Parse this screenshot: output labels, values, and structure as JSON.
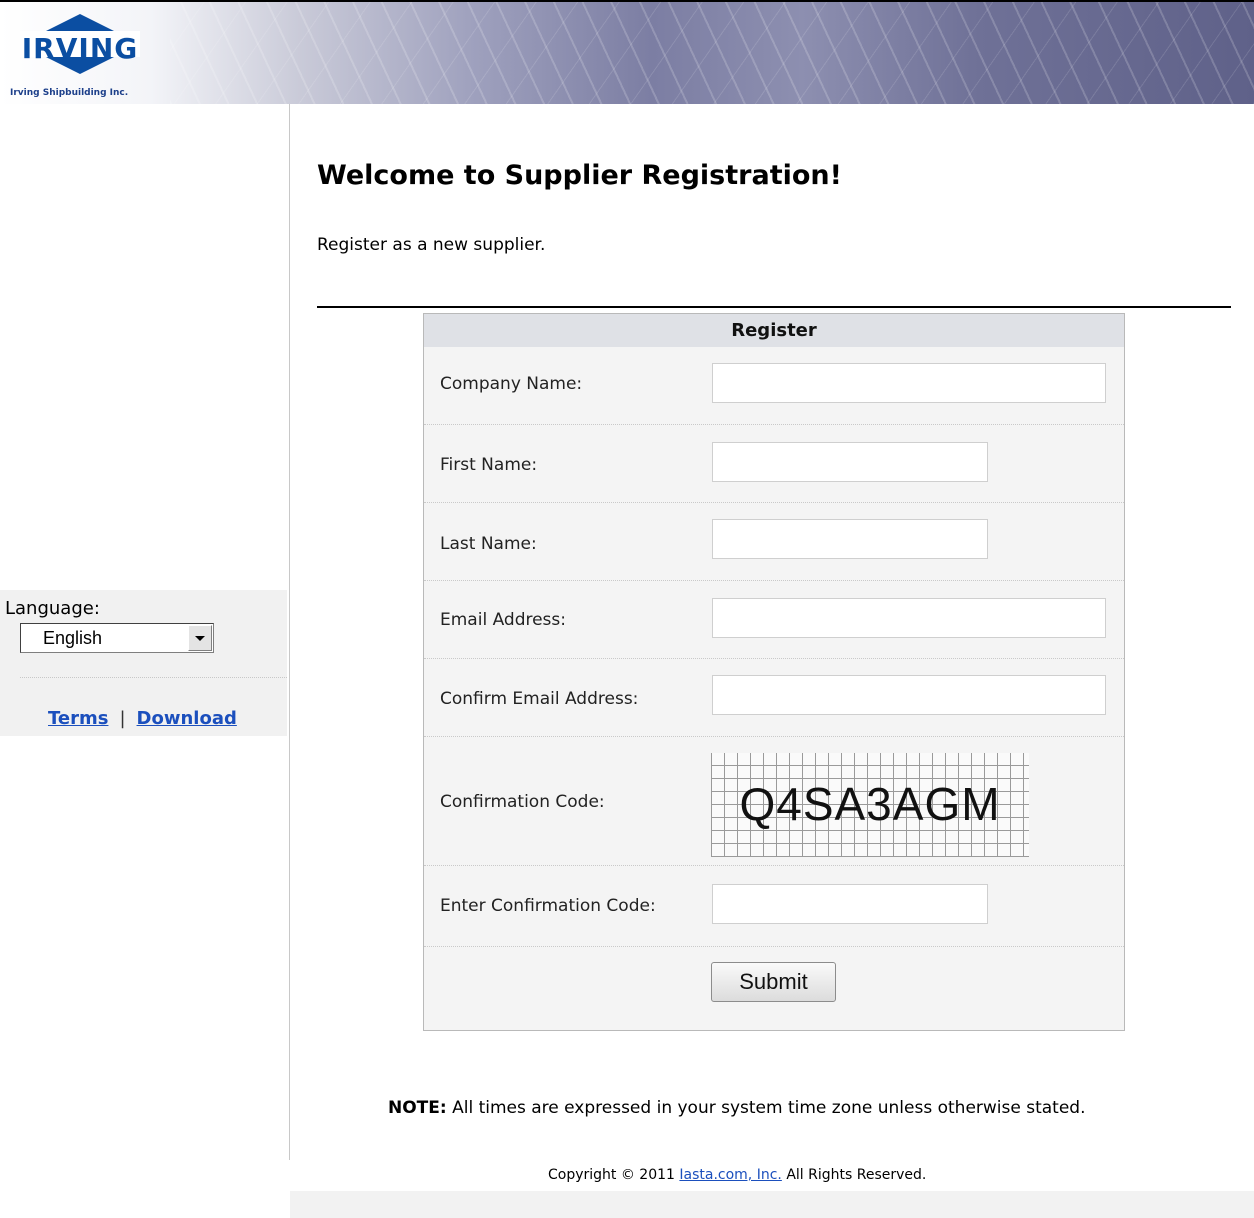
{
  "header": {
    "logo_text": "IRVING",
    "logo_subtitle": "Irving Shipbuilding Inc."
  },
  "sidebar": {
    "language_label": "Language:",
    "language_selected": "English",
    "terms_link": "Terms",
    "separator": "|",
    "download_link": "Download"
  },
  "main": {
    "title": "Welcome to Supplier Registration!",
    "subtitle": "Register as a new supplier."
  },
  "register": {
    "header": "Register",
    "fields": [
      {
        "label": "Company Name:",
        "value": ""
      },
      {
        "label": "First Name:",
        "value": ""
      },
      {
        "label": "Last Name:",
        "value": ""
      },
      {
        "label": "Email Address:",
        "value": ""
      },
      {
        "label": "Confirm Email Address:",
        "value": ""
      }
    ],
    "captcha_label": "Confirmation Code:",
    "captcha_code": "Q4SA3AGM",
    "enter_code_label": "Enter Confirmation Code:",
    "enter_code_value": "",
    "submit_label": "Submit"
  },
  "footer": {
    "note_bold": "NOTE:",
    "note_text": " All times are expressed in your system time zone unless otherwise stated.",
    "copyright_pre": "Copyright © 2011 ",
    "copyright_link": "Iasta.com, Inc.",
    "copyright_post": " All Rights Reserved."
  },
  "colors": {
    "link": "#1b4fbd",
    "logo_blue": "#0b4ea2",
    "panel_header": "#dfe1e6",
    "panel_bg": "#f4f4f4"
  }
}
